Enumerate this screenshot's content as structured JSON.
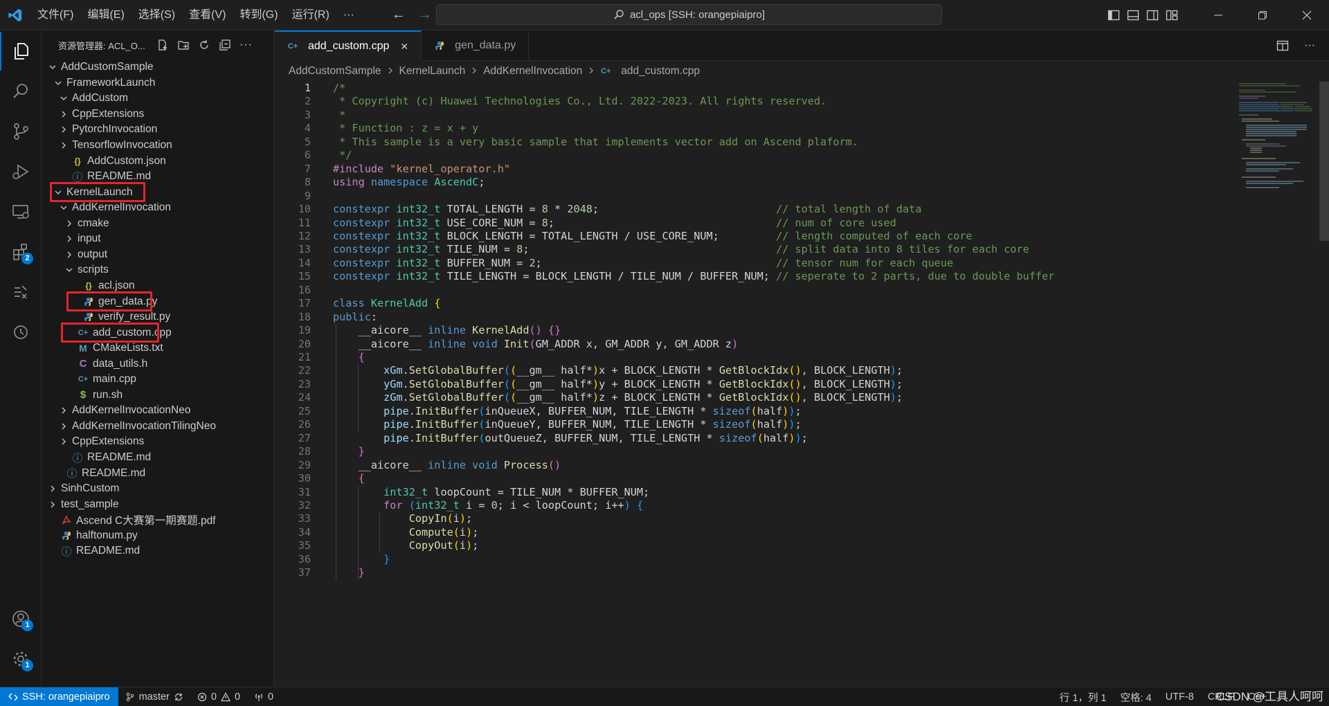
{
  "titlebar": {
    "menu": [
      "文件(F)",
      "编辑(E)",
      "选择(S)",
      "查看(V)",
      "转到(G)",
      "运行(R)",
      "···"
    ],
    "command_center": "acl_ops [SSH: orangepiaipro]"
  },
  "activity": {
    "accounts_badge": "1",
    "settings_badge": "1",
    "extensions_badge": "2"
  },
  "sidebar": {
    "title": "资源管理器: ACL_O...",
    "tree": [
      {
        "label": "AddCustomSample",
        "indent": 0,
        "chev": "down",
        "icon": ""
      },
      {
        "label": "FrameworkLaunch",
        "indent": 1,
        "chev": "down",
        "icon": ""
      },
      {
        "label": "AddCustom",
        "indent": 2,
        "chev": "down",
        "icon": ""
      },
      {
        "label": "CppExtensions",
        "indent": 2,
        "chev": "right",
        "icon": ""
      },
      {
        "label": "PytorchInvocation",
        "indent": 2,
        "chev": "right",
        "icon": ""
      },
      {
        "label": "TensorflowInvocation",
        "indent": 2,
        "chev": "right",
        "icon": ""
      },
      {
        "label": "AddCustom.json",
        "indent": 2,
        "chev": "",
        "icon": "json"
      },
      {
        "label": "README.md",
        "indent": 2,
        "chev": "",
        "icon": "info"
      },
      {
        "label": "KernelLaunch",
        "indent": 1,
        "chev": "down",
        "icon": ""
      },
      {
        "label": "AddKernelInvocation",
        "indent": 2,
        "chev": "down",
        "icon": ""
      },
      {
        "label": "cmake",
        "indent": 3,
        "chev": "right",
        "icon": ""
      },
      {
        "label": "input",
        "indent": 3,
        "chev": "right",
        "icon": ""
      },
      {
        "label": "output",
        "indent": 3,
        "chev": "right",
        "icon": ""
      },
      {
        "label": "scripts",
        "indent": 3,
        "chev": "down",
        "icon": ""
      },
      {
        "label": "acl.json",
        "indent": 4,
        "chev": "",
        "icon": "json"
      },
      {
        "label": "gen_data.py",
        "indent": 4,
        "chev": "",
        "icon": "py"
      },
      {
        "label": "verify_result.py",
        "indent": 4,
        "chev": "",
        "icon": "py"
      },
      {
        "label": "add_custom.cpp",
        "indent": 3,
        "chev": "",
        "icon": "cpp"
      },
      {
        "label": "CMakeLists.txt",
        "indent": 3,
        "chev": "",
        "icon": "cmake"
      },
      {
        "label": "data_utils.h",
        "indent": 3,
        "chev": "",
        "icon": "h"
      },
      {
        "label": "main.cpp",
        "indent": 3,
        "chev": "",
        "icon": "cpp"
      },
      {
        "label": "run.sh",
        "indent": 3,
        "chev": "",
        "icon": "sh"
      },
      {
        "label": "AddKernelInvocationNeo",
        "indent": 2,
        "chev": "right",
        "icon": ""
      },
      {
        "label": "AddKernelInvocationTilingNeo",
        "indent": 2,
        "chev": "right",
        "icon": ""
      },
      {
        "label": "CppExtensions",
        "indent": 2,
        "chev": "right",
        "icon": ""
      },
      {
        "label": "README.md",
        "indent": 2,
        "chev": "",
        "icon": "info"
      },
      {
        "label": "README.md",
        "indent": 1,
        "chev": "",
        "icon": "info"
      },
      {
        "label": "SinhCustom",
        "indent": 0,
        "chev": "right",
        "icon": ""
      },
      {
        "label": "test_sample",
        "indent": 0,
        "chev": "right",
        "icon": ""
      },
      {
        "label": "Ascend C大赛第一期赛题.pdf",
        "indent": 0,
        "chev": "",
        "icon": "pdf"
      },
      {
        "label": "halftonum.py",
        "indent": 0,
        "chev": "",
        "icon": "py"
      },
      {
        "label": "README.md",
        "indent": 0,
        "chev": "",
        "icon": "info"
      }
    ]
  },
  "tabs": [
    {
      "label": "add_custom.cpp",
      "active": true,
      "icon": "cpp"
    },
    {
      "label": "gen_data.py",
      "active": false,
      "icon": "py"
    }
  ],
  "breadcrumb": [
    "AddCustomSample",
    "KernelLaunch",
    "AddKernelInvocation",
    "add_custom.cpp"
  ],
  "code_lines": [
    [
      [
        "cm",
        "/*"
      ]
    ],
    [
      [
        "cm",
        " * Copyright (c) Huawei Technologies Co., Ltd. 2022-2023. All rights reserved."
      ]
    ],
    [
      [
        "cm",
        " *"
      ]
    ],
    [
      [
        "cm",
        " * Function : z = x + y"
      ]
    ],
    [
      [
        "cm",
        " * This sample is a very basic sample that implements vector add on Ascend plaform."
      ]
    ],
    [
      [
        "cm",
        " */"
      ]
    ],
    [
      [
        "pp",
        "#include "
      ],
      [
        "st",
        "\"kernel_operator.h\""
      ]
    ],
    [
      [
        "pp",
        "using "
      ],
      [
        "kw",
        "namespace "
      ],
      [
        "ty",
        "AscendC"
      ],
      [
        "pl",
        ";"
      ]
    ],
    [],
    [
      [
        "kw",
        "constexpr "
      ],
      [
        "ty",
        "int32_t "
      ],
      [
        "pl",
        "TOTAL_LENGTH = "
      ],
      [
        "nu",
        "8"
      ],
      [
        "pl",
        " * "
      ],
      [
        "nu",
        "2048"
      ],
      [
        "pl",
        ";                            "
      ],
      [
        "cm",
        "// total length of data"
      ]
    ],
    [
      [
        "kw",
        "constexpr "
      ],
      [
        "ty",
        "int32_t "
      ],
      [
        "pl",
        "USE_CORE_NUM = "
      ],
      [
        "nu",
        "8"
      ],
      [
        "pl",
        ";                                   "
      ],
      [
        "cm",
        "// num of core used"
      ]
    ],
    [
      [
        "kw",
        "constexpr "
      ],
      [
        "ty",
        "int32_t "
      ],
      [
        "pl",
        "BLOCK_LENGTH = TOTAL_LENGTH / USE_CORE_NUM;         "
      ],
      [
        "cm",
        "// length computed of each core"
      ]
    ],
    [
      [
        "kw",
        "constexpr "
      ],
      [
        "ty",
        "int32_t "
      ],
      [
        "pl",
        "TILE_NUM = "
      ],
      [
        "nu",
        "8"
      ],
      [
        "pl",
        ";                                       "
      ],
      [
        "cm",
        "// split data into 8 tiles for each core"
      ]
    ],
    [
      [
        "kw",
        "constexpr "
      ],
      [
        "ty",
        "int32_t "
      ],
      [
        "pl",
        "BUFFER_NUM = "
      ],
      [
        "nu",
        "2"
      ],
      [
        "pl",
        ";                                     "
      ],
      [
        "cm",
        "// tensor num for each queue"
      ]
    ],
    [
      [
        "kw",
        "constexpr "
      ],
      [
        "ty",
        "int32_t "
      ],
      [
        "pl",
        "TILE_LENGTH = BLOCK_LENGTH / TILE_NUM / BUFFER_NUM; "
      ],
      [
        "cm",
        "// seperate to 2 parts, due to double buffer"
      ]
    ],
    [],
    [
      [
        "kw",
        "class "
      ],
      [
        "ty",
        "KernelAdd "
      ],
      [
        "br1",
        "{"
      ]
    ],
    [
      [
        "kw",
        "public"
      ],
      [
        "pl",
        ":"
      ]
    ],
    [
      [
        "pl",
        "    __aicore__ "
      ],
      [
        "kw",
        "inline "
      ],
      [
        "fn",
        "KernelAdd"
      ],
      [
        "br2",
        "()"
      ],
      [
        "pl",
        " "
      ],
      [
        "br2",
        "{}"
      ]
    ],
    [
      [
        "pl",
        "    __aicore__ "
      ],
      [
        "kw",
        "inline void "
      ],
      [
        "fn",
        "Init"
      ],
      [
        "br2",
        "("
      ],
      [
        "pl",
        "GM_ADDR x, GM_ADDR y, GM_ADDR z"
      ],
      [
        "br2",
        ")"
      ]
    ],
    [
      [
        "pl",
        "    "
      ],
      [
        "br2",
        "{"
      ]
    ],
    [
      [
        "pl",
        "        "
      ],
      [
        "va",
        "xGm"
      ],
      [
        "pl",
        "."
      ],
      [
        "fn",
        "SetGlobalBuffer"
      ],
      [
        "br3",
        "("
      ],
      [
        "br1",
        "("
      ],
      [
        "pl",
        "__gm__ half*"
      ],
      [
        "br1",
        ")"
      ],
      [
        "pl",
        "x + BLOCK_LENGTH * "
      ],
      [
        "fn",
        "GetBlockIdx"
      ],
      [
        "br1",
        "()"
      ],
      [
        "pl",
        ", BLOCK_LENGTH"
      ],
      [
        "br3",
        ")"
      ],
      [
        "pl",
        ";"
      ]
    ],
    [
      [
        "pl",
        "        "
      ],
      [
        "va",
        "yGm"
      ],
      [
        "pl",
        "."
      ],
      [
        "fn",
        "SetGlobalBuffer"
      ],
      [
        "br3",
        "("
      ],
      [
        "br1",
        "("
      ],
      [
        "pl",
        "__gm__ half*"
      ],
      [
        "br1",
        ")"
      ],
      [
        "pl",
        "y + BLOCK_LENGTH * "
      ],
      [
        "fn",
        "GetBlockIdx"
      ],
      [
        "br1",
        "()"
      ],
      [
        "pl",
        ", BLOCK_LENGTH"
      ],
      [
        "br3",
        ")"
      ],
      [
        "pl",
        ";"
      ]
    ],
    [
      [
        "pl",
        "        "
      ],
      [
        "va",
        "zGm"
      ],
      [
        "pl",
        "."
      ],
      [
        "fn",
        "SetGlobalBuffer"
      ],
      [
        "br3",
        "("
      ],
      [
        "br1",
        "("
      ],
      [
        "pl",
        "__gm__ half*"
      ],
      [
        "br1",
        ")"
      ],
      [
        "pl",
        "z + BLOCK_LENGTH * "
      ],
      [
        "fn",
        "GetBlockIdx"
      ],
      [
        "br1",
        "()"
      ],
      [
        "pl",
        ", BLOCK_LENGTH"
      ],
      [
        "br3",
        ")"
      ],
      [
        "pl",
        ";"
      ]
    ],
    [
      [
        "pl",
        "        "
      ],
      [
        "va",
        "pipe"
      ],
      [
        "pl",
        "."
      ],
      [
        "fn",
        "InitBuffer"
      ],
      [
        "br3",
        "("
      ],
      [
        "pl",
        "inQueueX, BUFFER_NUM, TILE_LENGTH * "
      ],
      [
        "kw",
        "sizeof"
      ],
      [
        "br1",
        "("
      ],
      [
        "pl",
        "half"
      ],
      [
        "br1",
        ")"
      ],
      [
        "br3",
        ")"
      ],
      [
        "pl",
        ";"
      ]
    ],
    [
      [
        "pl",
        "        "
      ],
      [
        "va",
        "pipe"
      ],
      [
        "pl",
        "."
      ],
      [
        "fn",
        "InitBuffer"
      ],
      [
        "br3",
        "("
      ],
      [
        "pl",
        "inQueueY, BUFFER_NUM, TILE_LENGTH * "
      ],
      [
        "kw",
        "sizeof"
      ],
      [
        "br1",
        "("
      ],
      [
        "pl",
        "half"
      ],
      [
        "br1",
        ")"
      ],
      [
        "br3",
        ")"
      ],
      [
        "pl",
        ";"
      ]
    ],
    [
      [
        "pl",
        "        "
      ],
      [
        "va",
        "pipe"
      ],
      [
        "pl",
        "."
      ],
      [
        "fn",
        "InitBuffer"
      ],
      [
        "br3",
        "("
      ],
      [
        "pl",
        "outQueueZ, BUFFER_NUM, TILE_LENGTH * "
      ],
      [
        "kw",
        "sizeof"
      ],
      [
        "br1",
        "("
      ],
      [
        "pl",
        "half"
      ],
      [
        "br1",
        ")"
      ],
      [
        "br3",
        ")"
      ],
      [
        "pl",
        ";"
      ]
    ],
    [
      [
        "pl",
        "    "
      ],
      [
        "br2",
        "}"
      ]
    ],
    [
      [
        "pl",
        "    __aicore__ "
      ],
      [
        "kw",
        "inline void "
      ],
      [
        "fn",
        "Process"
      ],
      [
        "br2",
        "()"
      ]
    ],
    [
      [
        "pl",
        "    "
      ],
      [
        "br2",
        "{"
      ]
    ],
    [
      [
        "pl",
        "        "
      ],
      [
        "ty",
        "int32_t "
      ],
      [
        "pl",
        "loopCount = TILE_NUM * BUFFER_NUM;"
      ]
    ],
    [
      [
        "pl",
        "        "
      ],
      [
        "pp",
        "for "
      ],
      [
        "br3",
        "("
      ],
      [
        "ty",
        "int32_t "
      ],
      [
        "pl",
        "i = "
      ],
      [
        "nu",
        "0"
      ],
      [
        "pl",
        "; i < loopCount; i++"
      ],
      [
        "br3",
        ")"
      ],
      [
        "pl",
        " "
      ],
      [
        "br3",
        "{"
      ]
    ],
    [
      [
        "pl",
        "            "
      ],
      [
        "fn",
        "CopyIn"
      ],
      [
        "br1",
        "("
      ],
      [
        "pl",
        "i"
      ],
      [
        "br1",
        ")"
      ],
      [
        "pl",
        ";"
      ]
    ],
    [
      [
        "pl",
        "            "
      ],
      [
        "fn",
        "Compute"
      ],
      [
        "br1",
        "("
      ],
      [
        "pl",
        "i"
      ],
      [
        "br1",
        ")"
      ],
      [
        "pl",
        ";"
      ]
    ],
    [
      [
        "pl",
        "            "
      ],
      [
        "fn",
        "CopyOut"
      ],
      [
        "br1",
        "("
      ],
      [
        "pl",
        "i"
      ],
      [
        "br1",
        ")"
      ],
      [
        "pl",
        ";"
      ]
    ],
    [
      [
        "pl",
        "        "
      ],
      [
        "br3",
        "}"
      ]
    ],
    [
      [
        "pl",
        "    "
      ],
      [
        "br2",
        "}"
      ]
    ]
  ],
  "statusbar": {
    "remote": "SSH: orangepiaipro",
    "branch": "master",
    "errors": "0",
    "warnings": "0",
    "ports": "0",
    "position": "行 1，列 1",
    "spaces": "空格: 4",
    "encoding": "UTF-8",
    "eol": "CRLF",
    "language": "C++",
    "watermark": "CSDN @工具人呵呵"
  }
}
